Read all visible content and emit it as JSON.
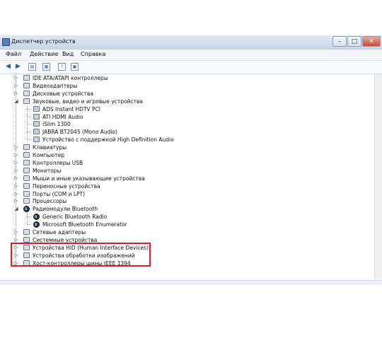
{
  "window": {
    "title": "Диспетчер устройств",
    "controls": {
      "minimize": "–",
      "maximize": "□",
      "close": "✕"
    }
  },
  "menu": [
    "Файл",
    "Действие",
    "Вид",
    "Справка"
  ],
  "toolbar": [
    "back",
    "forward",
    "properties",
    "scan",
    "help",
    "refresh"
  ],
  "tree": [
    {
      "label": "IDE ATA/ATAPI контроллеры",
      "level": 1,
      "expanded": false
    },
    {
      "label": "Видеоадаптеры",
      "level": 1,
      "expanded": false
    },
    {
      "label": "Дисковые устройства",
      "level": 1,
      "expanded": false
    },
    {
      "label": "Звуковые, видео и игровые устройства",
      "level": 1,
      "expanded": true
    },
    {
      "label": "ADS Instant HDTV PCI",
      "level": 2
    },
    {
      "label": "ATI HDMI Audio",
      "level": 2
    },
    {
      "label": "iSlim 1300",
      "level": 2
    },
    {
      "label": "JABRA BT2045 (Mono Audio)",
      "level": 2
    },
    {
      "label": "Устройство с поддержкой High Definition Audio",
      "level": 2
    },
    {
      "label": "Клавиатуры",
      "level": 1,
      "expanded": false
    },
    {
      "label": "Компьютер",
      "level": 1,
      "expanded": false
    },
    {
      "label": "Контроллеры USB",
      "level": 1,
      "expanded": false
    },
    {
      "label": "Мониторы",
      "level": 1,
      "expanded": false
    },
    {
      "label": "Мыши и иные указывающие устройства",
      "level": 1,
      "expanded": false
    },
    {
      "label": "Переносные устройства",
      "level": 1,
      "expanded": false
    },
    {
      "label": "Порты (COM и LPT)",
      "level": 1,
      "expanded": false
    },
    {
      "label": "Процессоры",
      "level": 1,
      "expanded": false
    },
    {
      "label": "Радиомодули Bluetooth",
      "level": 1,
      "expanded": true,
      "highlighted": true
    },
    {
      "label": "Generic Bluetooth Radio",
      "level": 2,
      "highlighted": true
    },
    {
      "label": "Microsoft Bluetooth Enumerator",
      "level": 2,
      "highlighted": true
    },
    {
      "label": "Сетевые адаптеры",
      "level": 1,
      "expanded": false
    },
    {
      "label": "Системные устройства",
      "level": 1,
      "expanded": false
    },
    {
      "label": "Устройства HID (Human Interface Devices)",
      "level": 1,
      "expanded": false
    },
    {
      "label": "Устройства обработки изображений",
      "level": 1,
      "expanded": false
    },
    {
      "label": "Хост-контроллеры шины IEEE 1394",
      "level": 1,
      "expanded": false
    }
  ],
  "colors": {
    "highlight_border": "#d4202a",
    "titlebar": "#c9d7ea"
  }
}
